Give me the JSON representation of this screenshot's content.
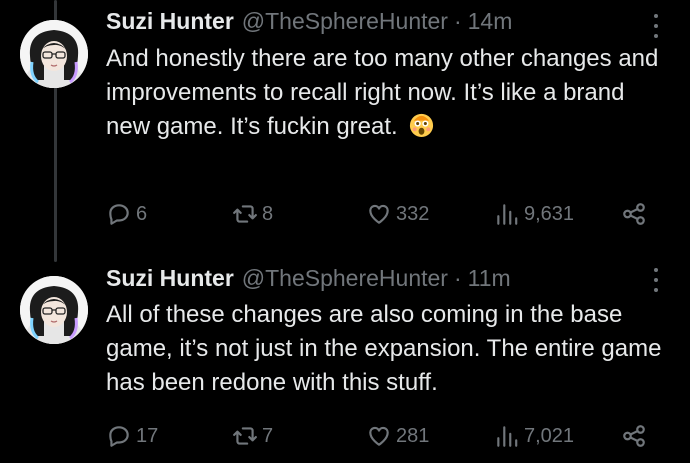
{
  "tweets": [
    {
      "author": {
        "name": "Suzi Hunter",
        "handle": "@TheSphereHunter"
      },
      "separator": "·",
      "time": "14m",
      "text": "And honestly there are too many other changes and improvements to recall right now. It’s like a brand new game. It’s fuckin great.",
      "emoji": "astonished-face-emoji",
      "stats": {
        "replies": "6",
        "retweets": "8",
        "likes": "332",
        "views": "9,631"
      }
    },
    {
      "author": {
        "name": "Suzi Hunter",
        "handle": "@TheSphereHunter"
      },
      "separator": "·",
      "time": "11m",
      "text": "All of these changes are also coming in the base game, it’s not just in the expansion. The entire game has been redone with this stuff.",
      "stats": {
        "replies": "17",
        "retweets": "7",
        "likes": "281",
        "views": "7,021"
      }
    }
  ],
  "icons": [
    "reply-icon",
    "retweet-icon",
    "like-icon",
    "views-icon",
    "share-icon",
    "more-icon"
  ],
  "colors": {
    "background": "#000000",
    "text": "#e7e9ea",
    "muted": "#71767b",
    "thread_line": "#333639"
  }
}
